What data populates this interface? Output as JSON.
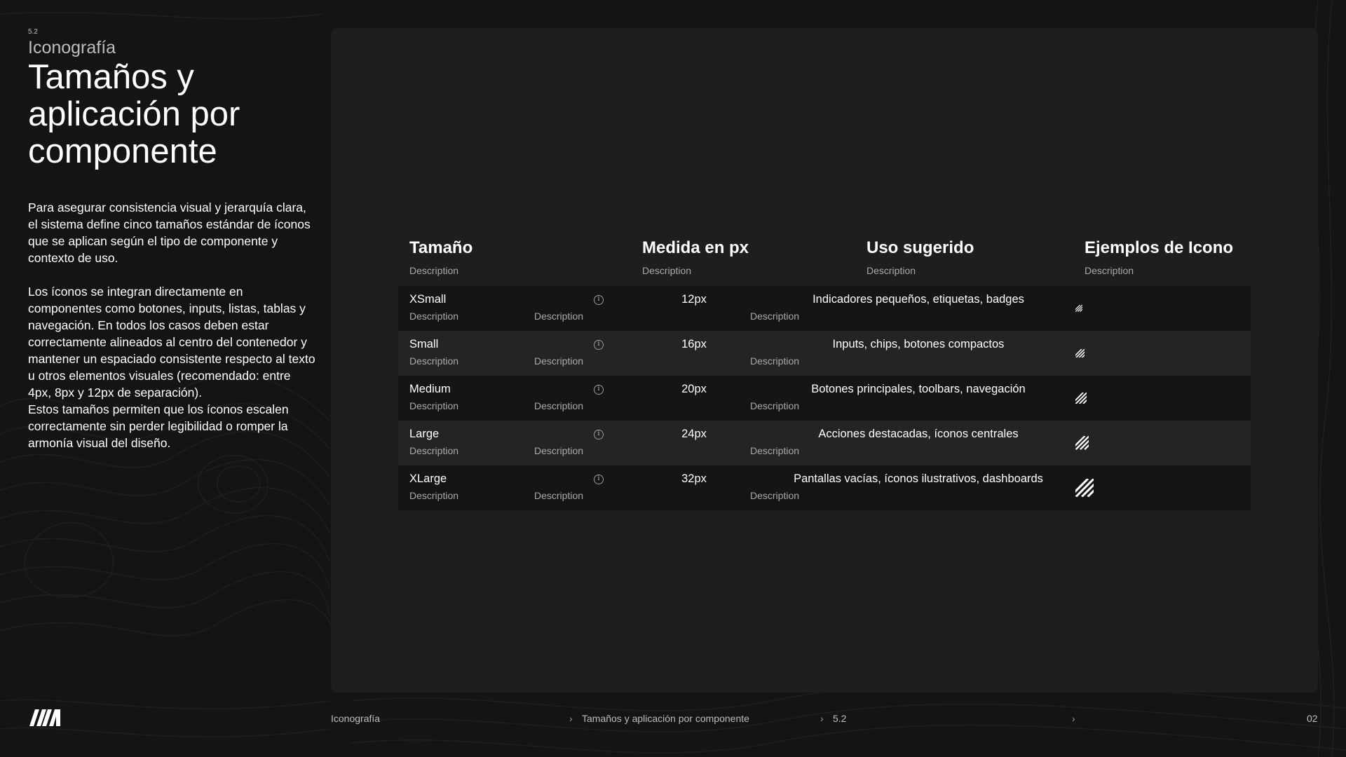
{
  "header": {
    "section_number": "5.2",
    "section_title": "Iconografía",
    "page_title": "Tamaños y aplicación por componente"
  },
  "intro": {
    "p1": "Para asegurar consistencia visual y jerarquía clara, el sistema define cinco tamaños estándar de íconos que se aplican según el tipo de componente y contexto de uso.",
    "p2": "Los íconos se integran directamente en componentes como botones, inputs, listas, tablas y navegación. En todos los casos deben estar correctamente alineados al centro del contenedor y mantener un espaciado consistente respecto al texto u otros elementos visuales (recomendado: entre 4px, 8px y 12px de separación).",
    "p3": "Estos tamaños permiten que los íconos escalen correctamente sin perder legibilidad o romper la armonía visual del diseño."
  },
  "table": {
    "columns": [
      {
        "title": "Tamaño",
        "description": "Description"
      },
      {
        "title": "Medida en px",
        "description": "Description"
      },
      {
        "title": "Uso sugerido",
        "description": "Description"
      },
      {
        "title": "Ejemplos de Icono",
        "description": "Description"
      }
    ],
    "rows": [
      {
        "size": "XSmall",
        "size_desc": "Description",
        "px": "12px",
        "px_desc": "Description",
        "use": "Indicadores pequeños, etiquetas, badges",
        "use_desc": "Description",
        "icon": "hatch-icon",
        "icon_size": 12
      },
      {
        "size": "Small",
        "size_desc": "Description",
        "px": "16px",
        "px_desc": "Description",
        "use": "Inputs, chips, botones compactos",
        "use_desc": "Description",
        "icon": "hatch-icon",
        "icon_size": 16
      },
      {
        "size": "Medium",
        "size_desc": "Description",
        "px": "20px",
        "px_desc": "Description",
        "use": "Botones principales, toolbars, navegación",
        "use_desc": "Description",
        "icon": "hatch-icon",
        "icon_size": 20
      },
      {
        "size": "Large",
        "size_desc": "Description",
        "px": "24px",
        "px_desc": "Description",
        "use": "Acciones destacadas, íconos centrales",
        "use_desc": "Description",
        "icon": "hatch-icon",
        "icon_size": 24
      },
      {
        "size": "XLarge",
        "size_desc": "Description",
        "px": "32px",
        "px_desc": "Description",
        "use": "Pantallas vacías, íconos ilustrativos, dashboards",
        "use_desc": "Description",
        "icon": "hatch-icon",
        "icon_size": 32
      }
    ]
  },
  "footer": {
    "logo": "brand-logo",
    "crumb1": "Iconografía",
    "crumb2": "Tamaños y aplicación por componente",
    "crumb3": "5.2",
    "page_number": "02"
  },
  "colors": {
    "background": "#141414",
    "panel": "#1e1e1e",
    "row_dark": "#151515",
    "row_light": "#242424",
    "muted_text": "#a9a9a9"
  }
}
